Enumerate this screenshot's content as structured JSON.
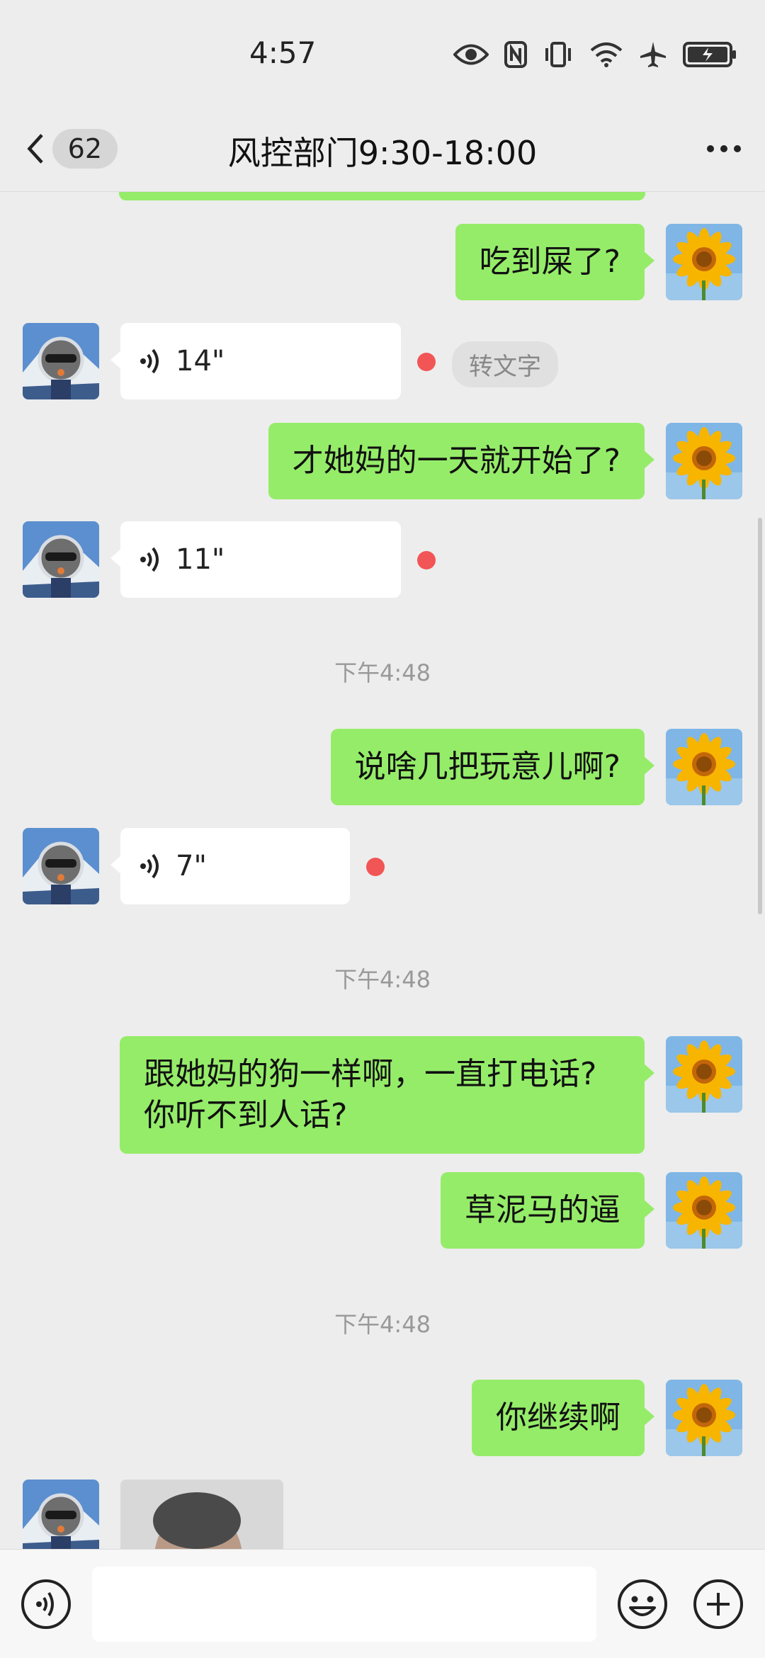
{
  "status_bar": {
    "time": "4:57"
  },
  "header": {
    "back_count": "62",
    "title": "风控部门9:30-18:00"
  },
  "messages": [
    {
      "side": "me",
      "type": "text",
      "text": "吃到屎了?"
    },
    {
      "side": "other",
      "type": "voice",
      "duration": "14\"",
      "unread": true,
      "transcribe_label": "转文字"
    },
    {
      "side": "me",
      "type": "text",
      "text": "才她妈的一天就开始了?"
    },
    {
      "side": "other",
      "type": "voice",
      "duration": "11\"",
      "unread": true
    },
    {
      "type": "timestamp",
      "text": "下午4:48"
    },
    {
      "side": "me",
      "type": "text",
      "text": "说啥几把玩意儿啊?"
    },
    {
      "side": "other",
      "type": "voice",
      "duration": "7\"",
      "unread": true
    },
    {
      "type": "timestamp",
      "text": "下午4:48"
    },
    {
      "side": "me",
      "type": "text",
      "lines": [
        "跟她妈的狗一样啊，一直打电话?",
        "你听不到人话?"
      ]
    },
    {
      "side": "me",
      "type": "text",
      "text": "草泥马的逼"
    },
    {
      "type": "timestamp",
      "text": "下午4:48"
    },
    {
      "side": "me",
      "type": "text",
      "text": "你继续啊"
    },
    {
      "side": "other",
      "type": "image"
    }
  ],
  "icons": {
    "back": "chevron-left-icon",
    "more": "more-dots-icon",
    "voice_input": "voice-input-icon",
    "emoji": "emoji-icon",
    "plus": "plus-icon"
  },
  "colors": {
    "my_bubble": "#95EC69",
    "other_bubble": "#FFFFFF",
    "background": "#EDEDED",
    "unread_dot": "#F25555"
  }
}
